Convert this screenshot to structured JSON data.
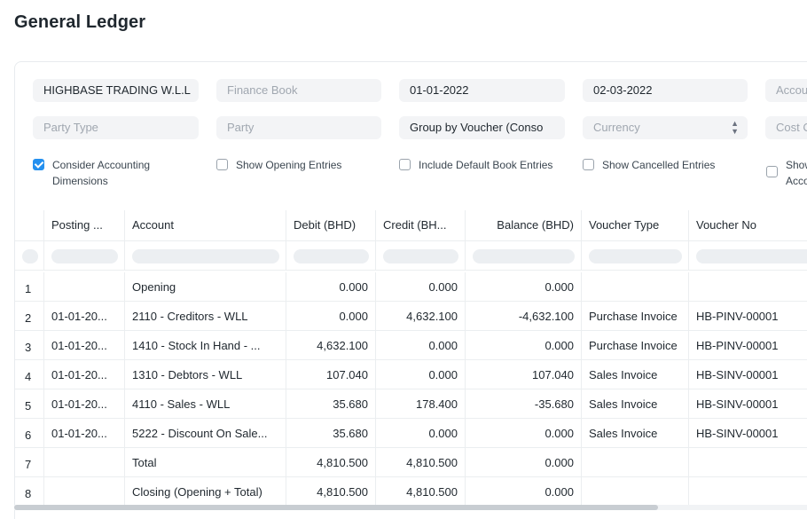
{
  "title": "General Ledger",
  "filters": {
    "company": "HIGHBASE TRADING W.L.L",
    "finance_book_placeholder": "Finance Book",
    "from_date": "01-01-2022",
    "to_date": "02-03-2022",
    "account_placeholder": "Accou",
    "party_type_placeholder": "Party Type",
    "party_placeholder": "Party",
    "group_by": "Group by Voucher (Conso",
    "currency_placeholder": "Currency",
    "cost_center_placeholder": "Cost C",
    "checkboxes": [
      {
        "label": "Consider Accounting",
        "label2": "Dimensions",
        "checked": true
      },
      {
        "label": "Show Opening Entries",
        "checked": false
      },
      {
        "label": "Include Default Book Entries",
        "checked": false
      },
      {
        "label": "Show Cancelled Entries",
        "checked": false
      },
      {
        "label": "Show",
        "label2": "Acco",
        "checked": false
      }
    ]
  },
  "table": {
    "columns": [
      "Posting ...",
      "Account",
      "Debit (BHD)",
      "Credit (BH...",
      "Balance (BHD)",
      "Voucher Type",
      "Voucher No"
    ],
    "rows": [
      {
        "idx": "1",
        "date": "",
        "account": "Opening",
        "debit": "0.000",
        "credit": "0.000",
        "balance": "0.000",
        "vtype": "",
        "vno": ""
      },
      {
        "idx": "2",
        "date": "01-01-20...",
        "account": "2110 - Creditors - WLL",
        "debit": "0.000",
        "credit": "4,632.100",
        "balance": "-4,632.100",
        "vtype": "Purchase Invoice",
        "vno": "HB-PINV-00001"
      },
      {
        "idx": "3",
        "date": "01-01-20...",
        "account": "1410 - Stock In Hand - ...",
        "debit": "4,632.100",
        "credit": "0.000",
        "balance": "0.000",
        "vtype": "Purchase Invoice",
        "vno": "HB-PINV-00001"
      },
      {
        "idx": "4",
        "date": "01-01-20...",
        "account": "1310 - Debtors - WLL",
        "debit": "107.040",
        "credit": "0.000",
        "balance": "107.040",
        "vtype": "Sales Invoice",
        "vno": "HB-SINV-00001"
      },
      {
        "idx": "5",
        "date": "01-01-20...",
        "account": "4110 - Sales - WLL",
        "debit": "35.680",
        "credit": "178.400",
        "balance": "-35.680",
        "vtype": "Sales Invoice",
        "vno": "HB-SINV-00001"
      },
      {
        "idx": "6",
        "date": "01-01-20...",
        "account": "5222 - Discount On Sale...",
        "debit": "35.680",
        "credit": "0.000",
        "balance": "0.000",
        "vtype": "Sales Invoice",
        "vno": "HB-SINV-00001"
      },
      {
        "idx": "7",
        "date": "",
        "account": "Total",
        "debit": "4,810.500",
        "credit": "4,810.500",
        "balance": "0.000",
        "vtype": "",
        "vno": ""
      },
      {
        "idx": "8",
        "date": "",
        "account": "Closing (Opening + Total)",
        "debit": "4,810.500",
        "credit": "4,810.500",
        "balance": "0.000",
        "vtype": "",
        "vno": ""
      }
    ]
  }
}
